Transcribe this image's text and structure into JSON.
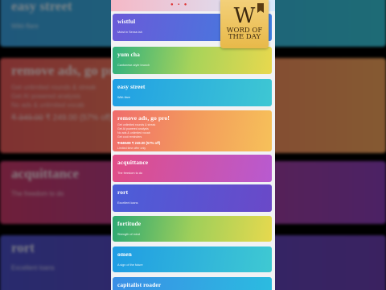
{
  "background_cards": [
    {
      "title": "easy street",
      "sub": "Wikt-flare",
      "lines": [],
      "price": ""
    },
    {
      "title": "remove ads, go pro!",
      "sub": "",
      "lines": [
        "Get unlimited rounds & streak",
        "Get AI powered analysis",
        "No ads & unlimited vocab"
      ],
      "price_old": "₹ 349.00",
      "price": "₹ 249.00 (57% off)"
    },
    {
      "title": "acquittance",
      "sub": "The freedom to do",
      "lines": [],
      "price": ""
    },
    {
      "title": "rort",
      "sub": "Excellent loans",
      "lines": [],
      "price": ""
    }
  ],
  "cards": [
    {
      "title": "wistful",
      "sub": "Moist in Sense-ish"
    },
    {
      "title": "yum cha",
      "sub": "Cantonese-style brunch"
    },
    {
      "title": "easy street",
      "sub": "Wikt-flare"
    },
    {
      "title": "remove ads, go pro!",
      "lines": [
        "Get unlimited rounds & streak",
        "Get AI powered analysis",
        "No ads & unlimited vocab",
        "Get cool reminders"
      ],
      "price_old": "₹ 349.00",
      "price": "₹ 249.00 (57% off)",
      "sub": "Limited time offer only"
    },
    {
      "title": "acquittance",
      "sub": "The freedom to do"
    },
    {
      "title": "rort",
      "sub": "Excellent loans"
    },
    {
      "title": "fortitude",
      "sub": "Strength of mind"
    },
    {
      "title": "omen",
      "sub": "A sign of the future"
    },
    {
      "title": "capitalist roader",
      "sub": ""
    }
  ],
  "badge": {
    "letter": "W",
    "text": "WORD OF THE DAY"
  },
  "watermark": "JN",
  "colors": {
    "purple_blue": "#6b5bd6",
    "green_yellow": "#3bb37a",
    "sky": "#2aa6e6",
    "coral": "#f0796a",
    "magenta": "#e0508f"
  }
}
